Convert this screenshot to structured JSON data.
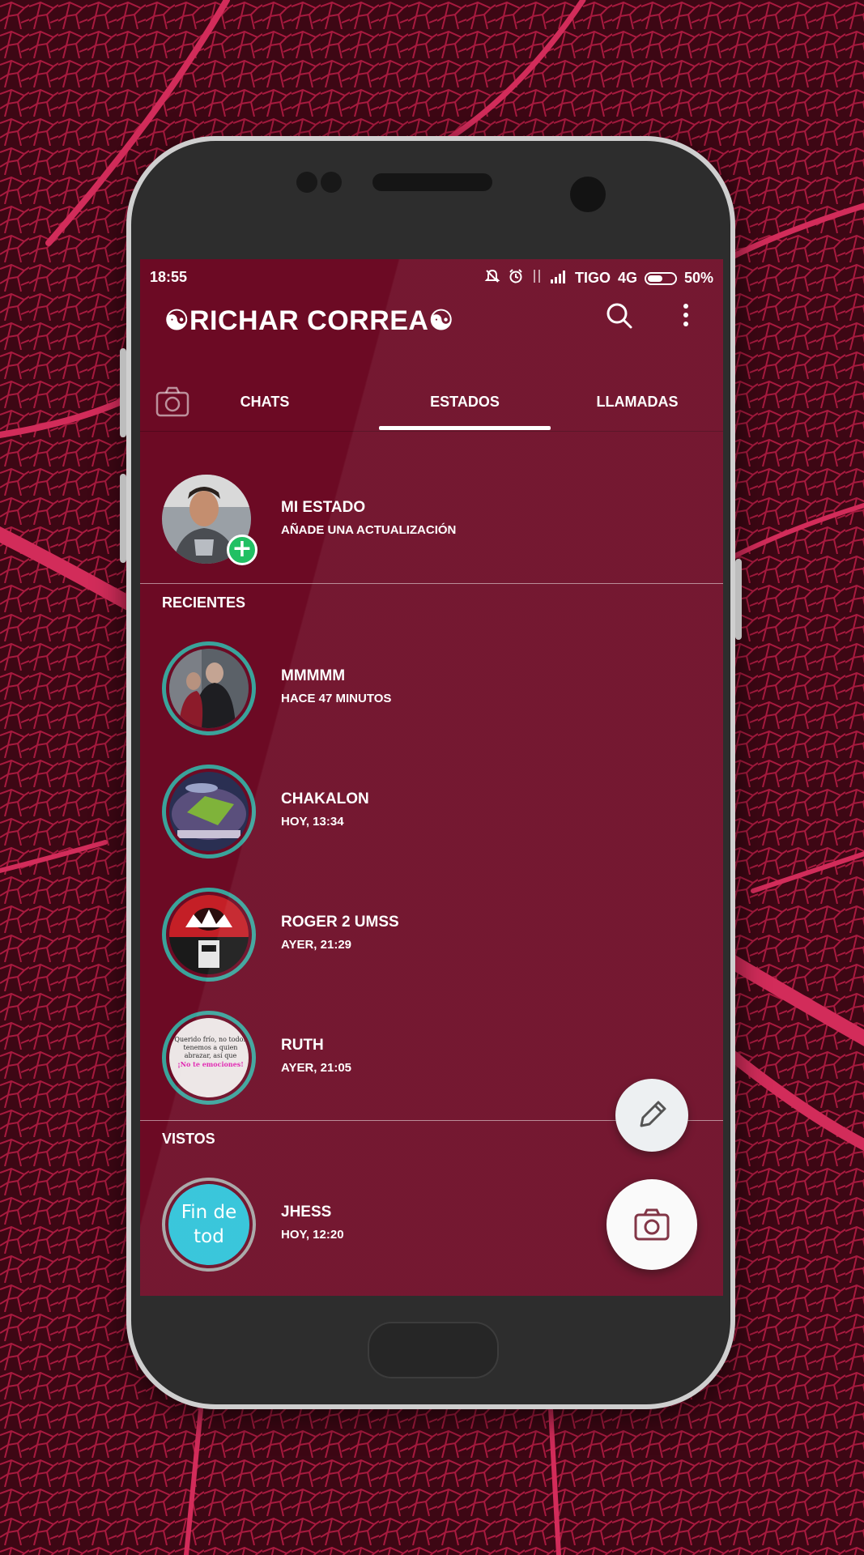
{
  "status_bar": {
    "time": "18:55",
    "carrier": "TIGO",
    "network": "4G",
    "battery": "50%"
  },
  "toolbar": {
    "title": "☯RICHAR CORREA☯",
    "search_icon": "search-icon",
    "more_icon": "more-vert-icon"
  },
  "tabs": [
    {
      "label": "CHATS",
      "active": false
    },
    {
      "label": "ESTADOS",
      "active": true
    },
    {
      "label": "LLAMADAS",
      "active": false
    }
  ],
  "my_status": {
    "title": "MI ESTADO",
    "subtitle": "AÑADE UNA ACTUALIZACIÓN"
  },
  "sections": {
    "recent": "RECIENTES",
    "seen": "VISTOS"
  },
  "recent_statuses": [
    {
      "name": "MMMMM",
      "time": "HACE 47 MINUTOS"
    },
    {
      "name": "CHAKALON",
      "time": "HOY, 13:34"
    },
    {
      "name": "ROGER 2 UMSS",
      "time": "AYER, 21:29"
    },
    {
      "name": "RUTH",
      "time": "AYER, 21:05"
    }
  ],
  "seen_statuses": [
    {
      "name": "JHESS",
      "time": "HOY, 12:20",
      "thumb_text": "Fin de tod"
    }
  ],
  "ruth_thumb": {
    "line1": "Querido frío, no todos tenemos a quien abrazar, así que",
    "line2": "¡No te emociones!"
  },
  "colors": {
    "app_background": "#6c0a24",
    "ring_unseen": "#3aa39b",
    "ring_seen": "#a5a5a5",
    "add_badge": "#21c063",
    "fin_thumb": "#2ec3d9"
  }
}
